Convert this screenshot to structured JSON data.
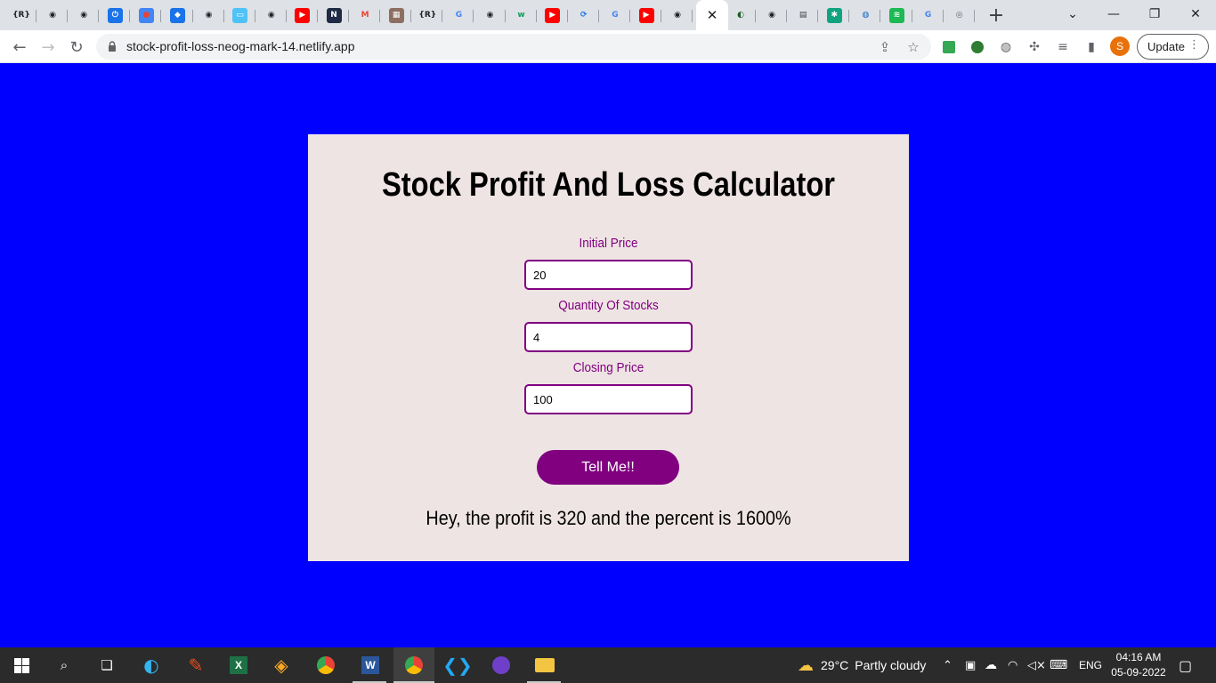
{
  "browser": {
    "tabs": [
      {
        "icon": "r-icon",
        "glyph": "{R}",
        "color": "#dee1e6",
        "fg": "#202124"
      },
      {
        "icon": "github-icon",
        "glyph": "◉",
        "color": "#dee1e6",
        "fg": "#202124"
      },
      {
        "icon": "github-icon",
        "glyph": "◉",
        "color": "#dee1e6",
        "fg": "#202124"
      },
      {
        "icon": "power-icon",
        "glyph": "⏻",
        "color": "#1a73e8",
        "fg": "#fff"
      },
      {
        "icon": "notification-icon",
        "glyph": "●",
        "color": "#4285f4",
        "fg": "#ea4335"
      },
      {
        "icon": "diamond-icon",
        "glyph": "◆",
        "color": "#1a73e8",
        "fg": "#fff"
      },
      {
        "icon": "github-icon",
        "glyph": "◉",
        "color": "#dee1e6",
        "fg": "#202124"
      },
      {
        "icon": "laptop-icon",
        "glyph": "▭",
        "color": "#4fc3f7",
        "fg": "#fff"
      },
      {
        "icon": "github-icon",
        "glyph": "◉",
        "color": "#dee1e6",
        "fg": "#202124"
      },
      {
        "icon": "youtube-icon",
        "glyph": "▶",
        "color": "#ff0000",
        "fg": "#fff"
      },
      {
        "icon": "neog-icon",
        "glyph": "N",
        "color": "#1f2a44",
        "fg": "#fff"
      },
      {
        "icon": "gmail-icon",
        "glyph": "M",
        "color": "#dee1e6",
        "fg": "#ea4335"
      },
      {
        "icon": "image-icon",
        "glyph": "▦",
        "color": "#8d6e63",
        "fg": "#fff"
      },
      {
        "icon": "r-icon",
        "glyph": "{R}",
        "color": "#dee1e6",
        "fg": "#202124"
      },
      {
        "icon": "google-icon",
        "glyph": "G",
        "color": "#dee1e6",
        "fg": "#4285f4"
      },
      {
        "icon": "github-icon",
        "glyph": "◉",
        "color": "#dee1e6",
        "fg": "#202124"
      },
      {
        "icon": "w-icon",
        "glyph": "w",
        "color": "#dee1e6",
        "fg": "#0f9d58"
      },
      {
        "icon": "youtube-icon",
        "glyph": "▶",
        "color": "#ff0000",
        "fg": "#fff"
      },
      {
        "icon": "netlify-icon",
        "glyph": "⟳",
        "color": "#dee1e6",
        "fg": "#1a73e8"
      },
      {
        "icon": "google-icon",
        "glyph": "G",
        "color": "#dee1e6",
        "fg": "#4285f4"
      },
      {
        "icon": "youtube-icon",
        "glyph": "▶",
        "color": "#ff0000",
        "fg": "#fff"
      },
      {
        "icon": "github-icon",
        "glyph": "◉",
        "color": "#dee1e6",
        "fg": "#202124"
      }
    ],
    "tabs_after": [
      {
        "icon": "globe-icon",
        "glyph": "◐",
        "color": "#dee1e6",
        "fg": "#1b5e20"
      },
      {
        "icon": "github-icon",
        "glyph": "◉",
        "color": "#dee1e6",
        "fg": "#202124"
      },
      {
        "icon": "document-icon",
        "glyph": "▤",
        "color": "#dee1e6",
        "fg": "#3c4043"
      },
      {
        "icon": "chatgpt-icon",
        "glyph": "✱",
        "color": "#10a37f",
        "fg": "#fff"
      },
      {
        "icon": "earth-icon",
        "glyph": "◍",
        "color": "#dee1e6",
        "fg": "#1565c0"
      },
      {
        "icon": "spotify-icon",
        "glyph": "≋",
        "color": "#1db954",
        "fg": "#fff"
      },
      {
        "icon": "google-icon",
        "glyph": "G",
        "color": "#dee1e6",
        "fg": "#4285f4"
      },
      {
        "icon": "chrome-icon",
        "glyph": "◎",
        "color": "#dee1e6",
        "fg": "#5f6368"
      }
    ],
    "active_tab_close": "✕",
    "new_tab": "+",
    "url": "stock-profit-loss-neog-mark-14.netlify.app",
    "update_label": "Update",
    "profile_initial": "S"
  },
  "app": {
    "title": "Stock Profit And Loss Calculator",
    "fields": [
      {
        "label": "Initial Price",
        "value": "20"
      },
      {
        "label": "Quantity Of Stocks",
        "value": "4"
      },
      {
        "label": "Closing Price",
        "value": "100"
      }
    ],
    "button_label": "Tell Me!!",
    "output": "Hey, the profit is 320 and the percent is 1600%",
    "background": "#0000ff",
    "card_color": "#efe4e4",
    "accent": "#800080"
  },
  "taskbar": {
    "weather_temp": "29°C",
    "weather_desc": "Partly cloudy",
    "language": "ENG",
    "time": "04:16 AM",
    "date": "05-09-2022"
  }
}
